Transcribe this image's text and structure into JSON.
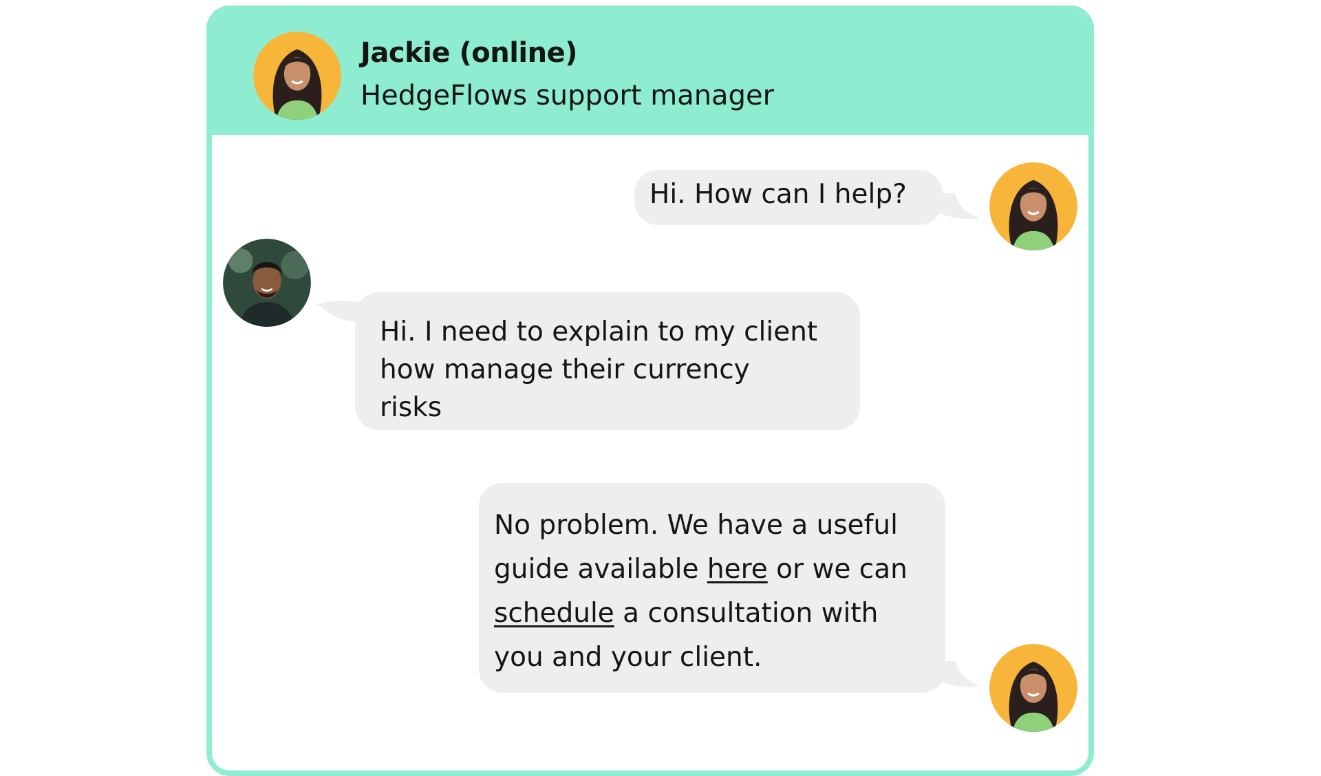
{
  "header": {
    "agent_name": "Jackie (online)",
    "agent_role": "HedgeFlows support manager"
  },
  "messages": [
    {
      "sender": "agent",
      "text": "Hi. How can I help?"
    },
    {
      "sender": "user",
      "lines": [
        "Hi. I need to explain to my client",
        "how manage their currency",
        "risks"
      ]
    },
    {
      "sender": "agent",
      "parts": {
        "p1": "No problem. We have a useful guide available ",
        "link1": "here",
        "p2": " or we can ",
        "link2": "schedule",
        "p3": " a consultation with you and your client."
      }
    }
  ],
  "icons": {
    "agent_avatar": "woman-portrait-avatar",
    "user_avatar": "man-portrait-avatar"
  },
  "colors": {
    "header_bg": "#8eedd0",
    "border": "#8eedd0",
    "bubble_bg": "#eeeeee",
    "agent_avatar_bg": "#f7b53a"
  }
}
